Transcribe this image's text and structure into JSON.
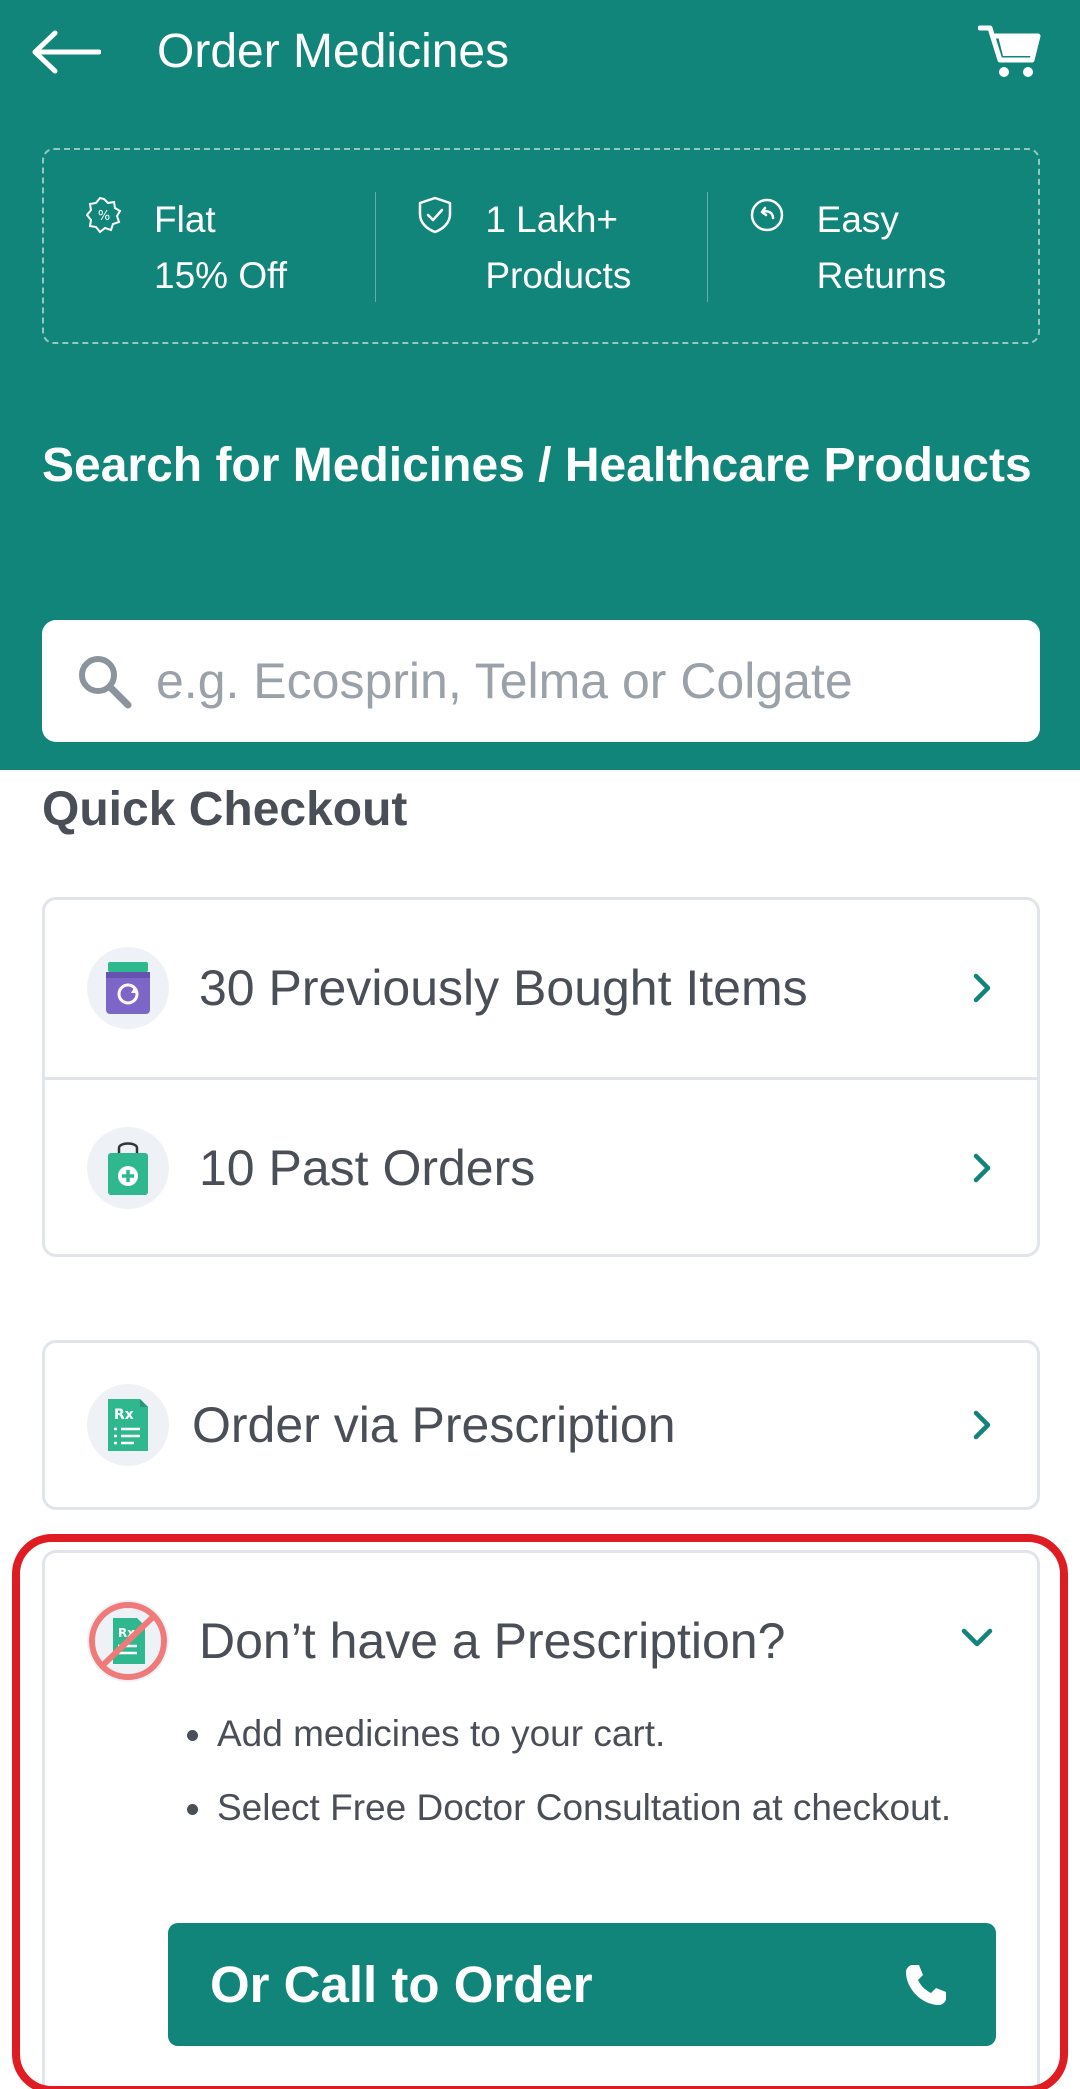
{
  "header": {
    "title": "Order Medicines",
    "back_icon": "arrow-left-icon",
    "cart_icon": "cart-icon",
    "background_color": "#12857b"
  },
  "benefits": [
    {
      "icon": "discount-badge-icon",
      "line1": "Flat",
      "line2": "15% Off"
    },
    {
      "icon": "shield-check-icon",
      "line1": "1 Lakh+",
      "line2": "Products"
    },
    {
      "icon": "return-arrow-icon",
      "line1": "Easy",
      "line2": "Returns"
    }
  ],
  "search": {
    "heading": "Search for Medicines / Healthcare Products",
    "placeholder": "e.g. Ecosprin, Telma or Colgate",
    "value": ""
  },
  "quick_checkout": {
    "title": "Quick Checkout",
    "items": [
      {
        "label": "30 Previously Bought Items",
        "icon": "medicine-jar-icon"
      },
      {
        "label": "10 Past Orders",
        "icon": "shopping-bag-plus-icon"
      }
    ]
  },
  "prescription": {
    "label": "Order via Prescription",
    "icon": "prescription-document-icon"
  },
  "no_prescription": {
    "title": "Don’t have a Prescription?",
    "icon": "no-prescription-icon",
    "expanded": true,
    "bullets": [
      "Add medicines to your cart.",
      "Select Free Doctor Consultation at checkout."
    ],
    "call_button": "Or Call to Order",
    "call_icon": "phone-icon",
    "highlight_color": "#e01c23"
  }
}
